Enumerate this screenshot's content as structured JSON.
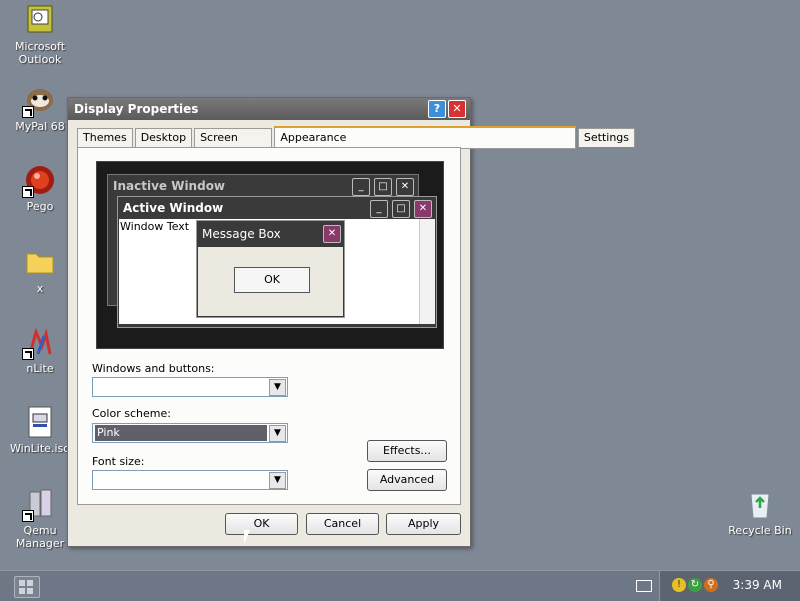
{
  "desktop": {
    "icons": [
      {
        "label": "Microsoft Outlook",
        "icon": "outlook-icon"
      },
      {
        "label": "MyPal 68",
        "icon": "mypal-icon"
      },
      {
        "label": "Pego",
        "icon": "pego-icon"
      },
      {
        "label": "x",
        "icon": "folder-icon"
      },
      {
        "label": "nLite",
        "icon": "nlite-icon"
      },
      {
        "label": "WinLite.iso",
        "icon": "iso-file-icon"
      },
      {
        "label": "Qemu Manager",
        "icon": "qemu-icon"
      },
      {
        "label": "Recycle Bin",
        "icon": "recycle-bin-icon"
      }
    ]
  },
  "dialog": {
    "title": "Display Properties",
    "help_glyph": "?",
    "close_glyph": "✕",
    "tabs": [
      "Themes",
      "Desktop",
      "Screen Saver",
      "Appearance",
      "Settings"
    ],
    "active_tab": "Appearance",
    "preview": {
      "inactive_title": "Inactive Window",
      "active_title": "Active Window",
      "window_text": "Window Text",
      "message_title": "Message Box",
      "message_ok": "OK"
    },
    "windows_and_buttons_label": "Windows and buttons:",
    "windows_and_buttons_value": "",
    "color_scheme_label": "Color scheme:",
    "color_scheme_value": "Pink",
    "font_size_label": "Font size:",
    "font_size_value": "",
    "effects_button": "Effects...",
    "advanced_button": "Advanced",
    "ok_button": "OK",
    "cancel_button": "Cancel",
    "apply_button": "Apply"
  },
  "taskbar": {
    "clock": "3:39 AM"
  },
  "colors": {
    "desktop_bg": "#7f8895",
    "close_red": "#d93030",
    "help_blue": "#3d8fd8",
    "scheme_highlight": "#60606a"
  }
}
